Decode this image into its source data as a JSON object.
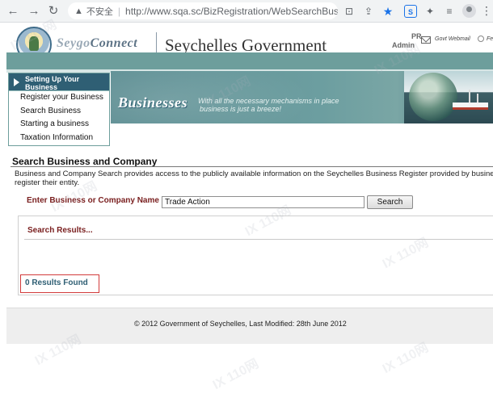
{
  "browser": {
    "insecure_label": "不安全",
    "url": "http://www.sqa.sc/BizRegistration/WebSearchBusi...",
    "translate_label": "CH",
    "icons": [
      "back-arrow-icon",
      "forward-arrow-icon",
      "reload-icon",
      "warning-icon",
      "translate-icon",
      "share-icon",
      "star-icon",
      "extension-s-icon",
      "puzzle-icon",
      "media-icon",
      "profile-icon",
      "menu-icon"
    ]
  },
  "header": {
    "logo_text_a": "Seygo",
    "logo_text_b": "Connect",
    "title": "Seychelles Government",
    "admin_pr": "PR",
    "admin": "Admin",
    "webmail": "Govt Webmail",
    "fe": "Fe"
  },
  "sidebar": {
    "heading_line1": "Setting Up Your",
    "heading_line2": "Business",
    "items": [
      {
        "label": "Register your Business"
      },
      {
        "label": "Search Business"
      },
      {
        "label": "Starting a business"
      },
      {
        "label": "Taxation Information"
      }
    ]
  },
  "banner": {
    "title": "Businesses",
    "subtitle_line1": "With all the necessary mechanisms in place",
    "subtitle_line2": "business is just a breeze!"
  },
  "main": {
    "heading": "Search Business and Company",
    "intro_line1": "Business and Company Search provides access to the publicly available information on the Seychelles Business Register provided by businesses w",
    "intro_line2": "register their entity.",
    "search_label": "Enter Business or Company Name",
    "search_value": "Trade Action",
    "search_button": "Search",
    "results_title": "Search Results...",
    "results_found": "0 Results Found"
  },
  "footer": {
    "text": "© 2012 Government of Seychelles, Last Modified: 28th June 2012"
  },
  "watermark": "IX 110网",
  "colors": {
    "teal": "#6d9e9c",
    "navy_teal": "#2f5f74",
    "label_red": "#7a2020",
    "highlight_red": "#d23b3b"
  }
}
